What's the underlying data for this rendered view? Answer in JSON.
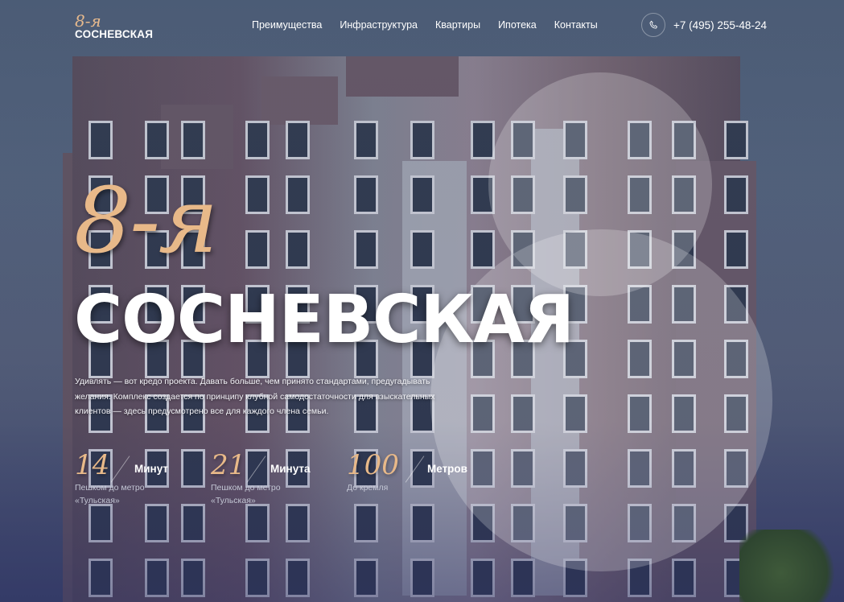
{
  "header": {
    "logo_script": "8-я",
    "logo_name": "СОСНЕВСКАЯ",
    "nav": [
      "Преимущества",
      "Инфраструктура",
      "Квартиры",
      "Ипотека",
      "Контакты"
    ],
    "phone_icon": "phone-icon",
    "phone": "+7 (495) 255-48-24"
  },
  "hero": {
    "script": "8-я",
    "title": "СОСНЕВСКАЯ",
    "description": "Удивлять — вот кредо проекта. Давать больше, чем принято стандартами, предугадывать желания. Комплекс создается по принципу клубной самодостаточности для взыскательных клиентов — здесь предусмотрено все для каждого члена семьи."
  },
  "stats": [
    {
      "number": "14",
      "unit": "Минут",
      "caption": "Пешком до метро «Тульская»"
    },
    {
      "number": "21",
      "unit": "Минута",
      "caption": "Пешком до метро «Тульская»"
    },
    {
      "number": "100",
      "unit": "Метров",
      "caption": "До кремля"
    }
  ],
  "colors": {
    "accent": "#e8b989",
    "text": "#ffffff",
    "muted": "#c3c6d4"
  }
}
